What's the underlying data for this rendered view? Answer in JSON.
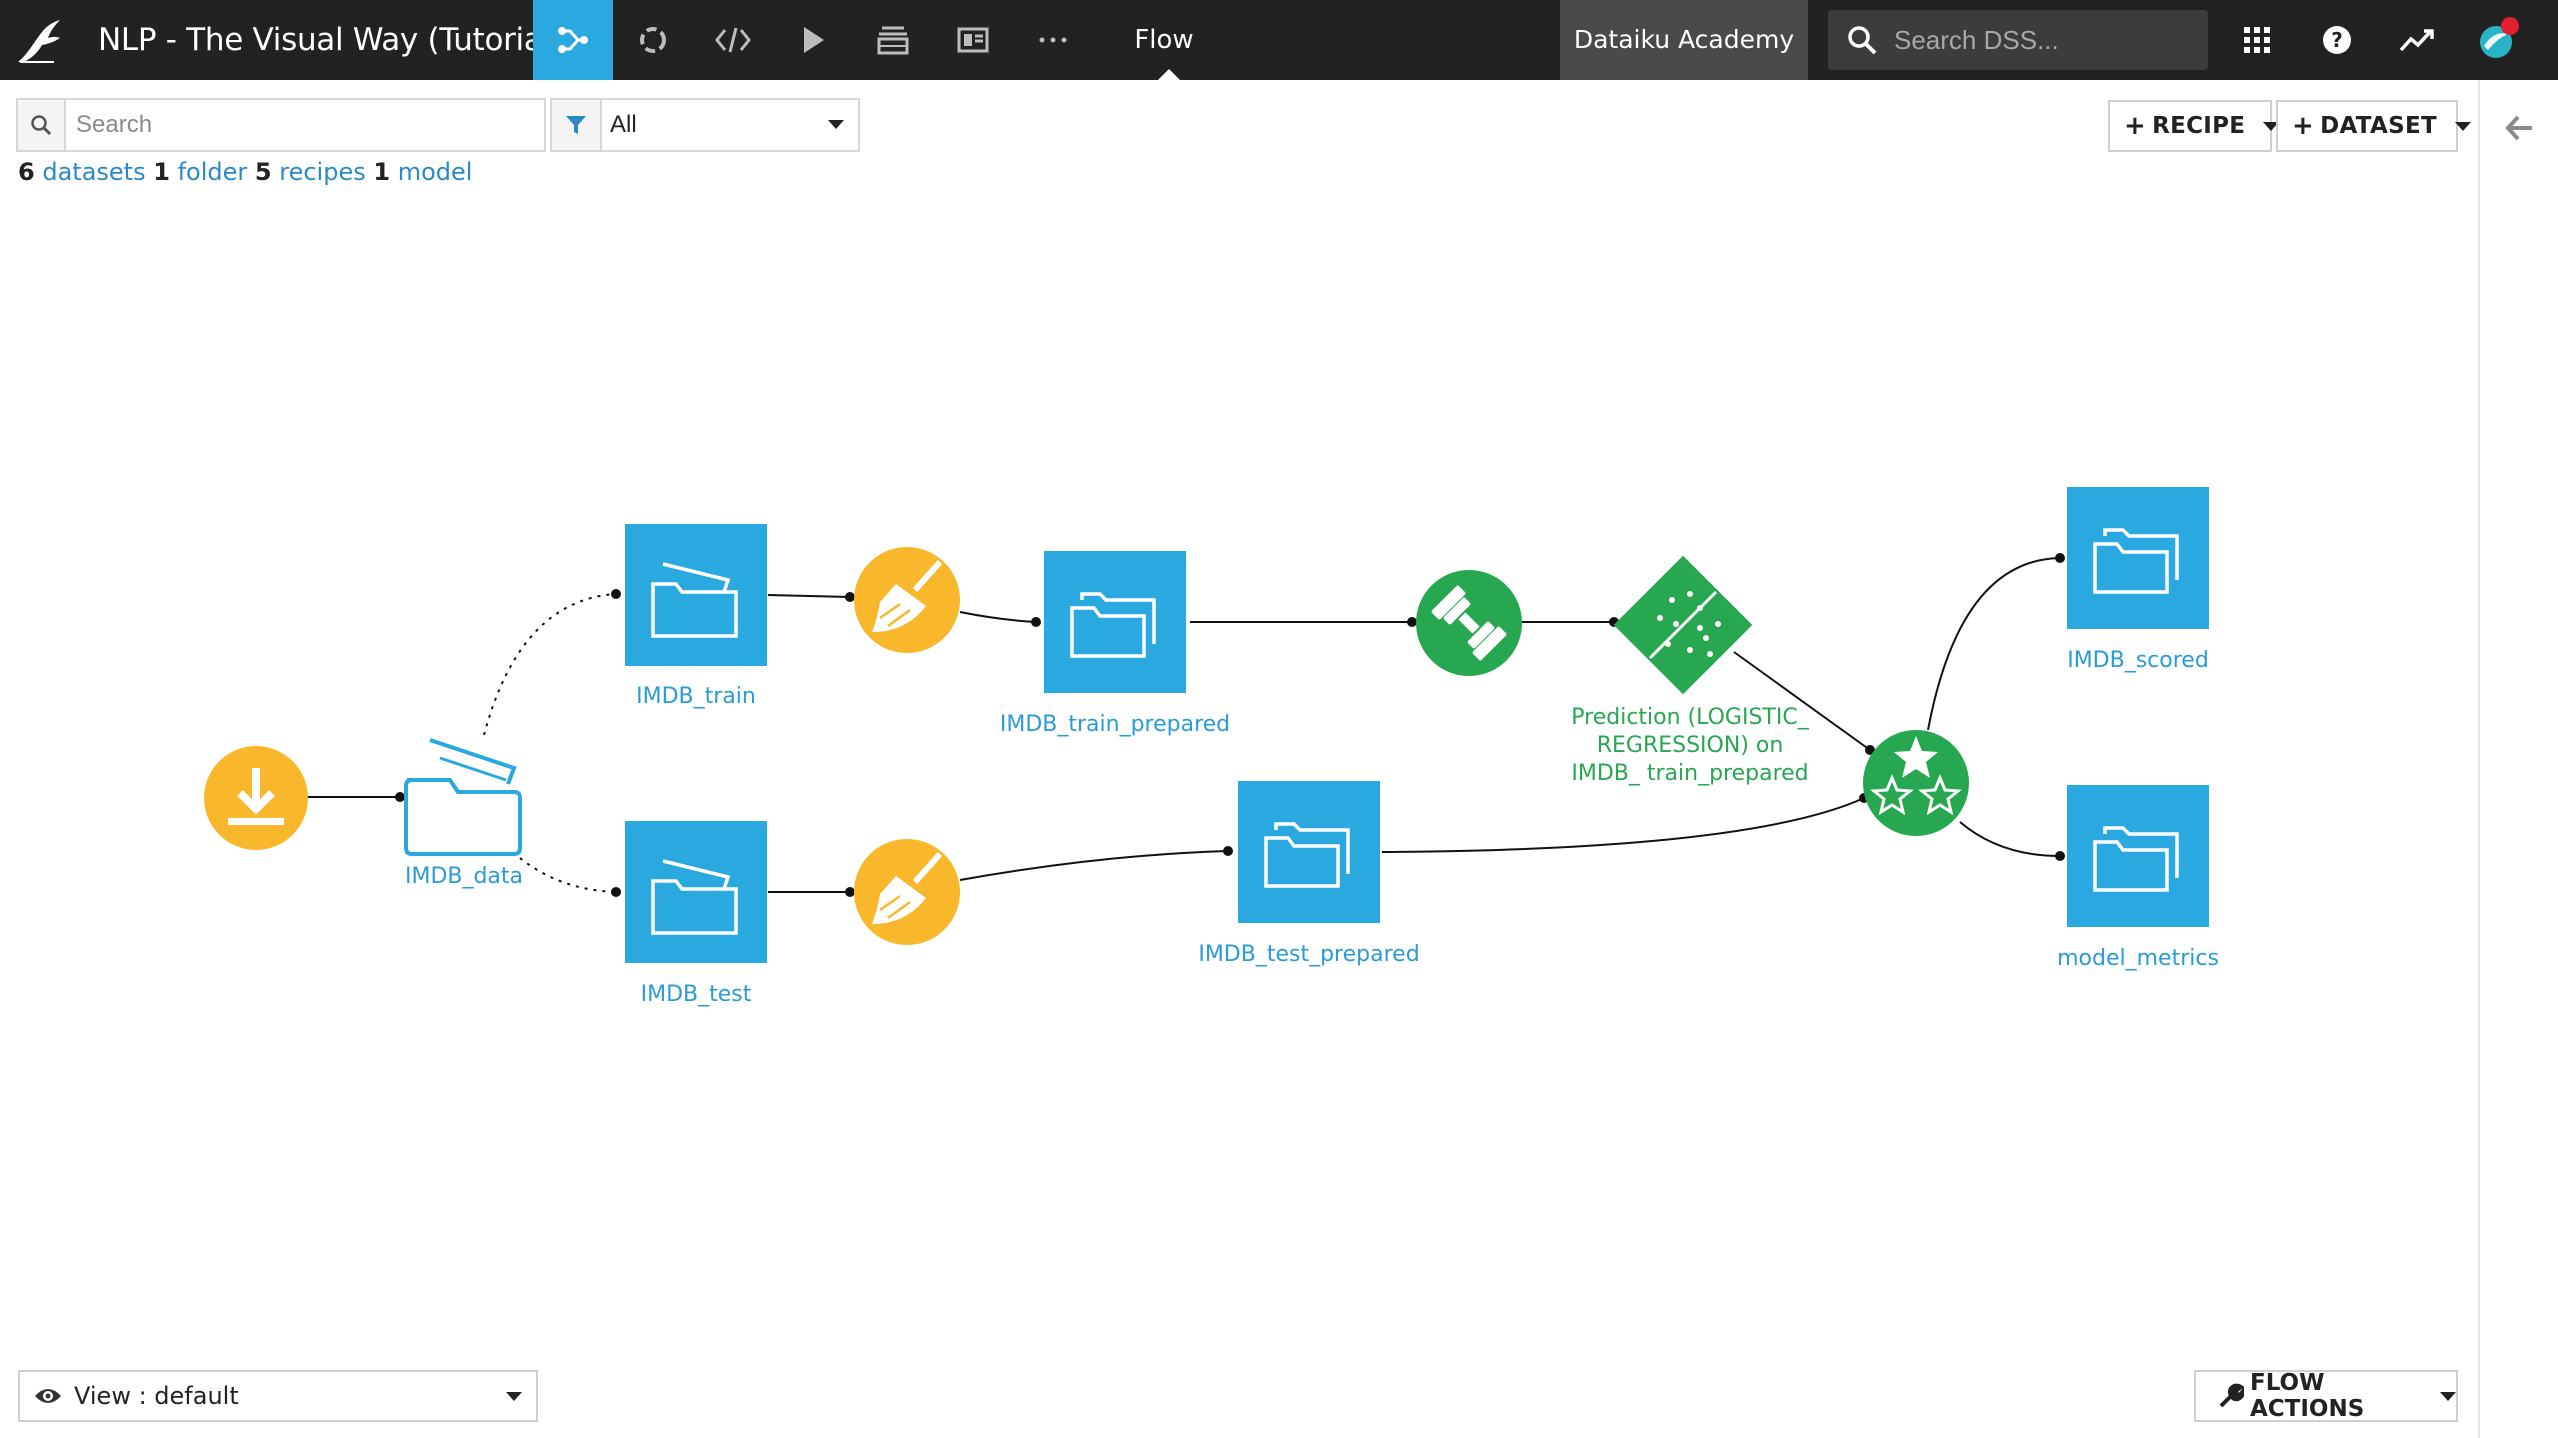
{
  "project": {
    "title": "NLP - The Visual Way (Tutorial)"
  },
  "nav": {
    "active_tab": "Flow",
    "flow_tab_label": "Flow",
    "academy_label": "Dataiku Academy",
    "search_placeholder": "Search DSS...",
    "icons": [
      "flow-icon",
      "jobs-icon",
      "code-icon",
      "run-icon",
      "stack-icon",
      "dashboard-icon",
      "more-icon",
      "apps-grid-icon",
      "help-icon",
      "activity-icon",
      "avatar-icon"
    ],
    "colors": {
      "bar": "#222222",
      "active": "#2aa9e0",
      "notification": "#e0202e"
    }
  },
  "filter": {
    "search_placeholder": "Search",
    "filter_value": "All"
  },
  "counts": [
    {
      "n": "6",
      "label": "datasets"
    },
    {
      "n": "1",
      "label": "folder"
    },
    {
      "n": "5",
      "label": "recipes"
    },
    {
      "n": "1",
      "label": "model"
    }
  ],
  "buttons": {
    "recipe": "RECIPE",
    "dataset": "DATASET",
    "flow_actions": "FLOW ACTIONS"
  },
  "view": {
    "label": "View : default"
  },
  "colors": {
    "dataset": "#2aa9e0",
    "recipe_prepare": "#f9b72b",
    "ml": "#27a750",
    "link": "#2a8ac7"
  },
  "flow": {
    "nodes": {
      "download": {
        "kind": "download-recipe"
      },
      "imdb_data": {
        "kind": "folder",
        "label": "IMDB_data"
      },
      "imdb_train": {
        "kind": "dataset",
        "label": "IMDB_train"
      },
      "imdb_test": {
        "kind": "dataset",
        "label": "IMDB_test"
      },
      "prep_train": {
        "kind": "prepare-recipe"
      },
      "prep_test": {
        "kind": "prepare-recipe"
      },
      "train_prepared": {
        "kind": "dataset",
        "label": "IMDB_train_prepared"
      },
      "test_prepared": {
        "kind": "dataset",
        "label": "IMDB_test_prepared"
      },
      "train_recipe": {
        "kind": "train-recipe"
      },
      "model": {
        "kind": "model",
        "label": "Prediction (LOGISTIC_ REGRESSION) on IMDB_ train_prepared"
      },
      "score": {
        "kind": "score-recipe"
      },
      "scored": {
        "kind": "dataset",
        "label": "IMDB_scored"
      },
      "metrics": {
        "kind": "dataset",
        "label": "model_metrics"
      }
    }
  }
}
